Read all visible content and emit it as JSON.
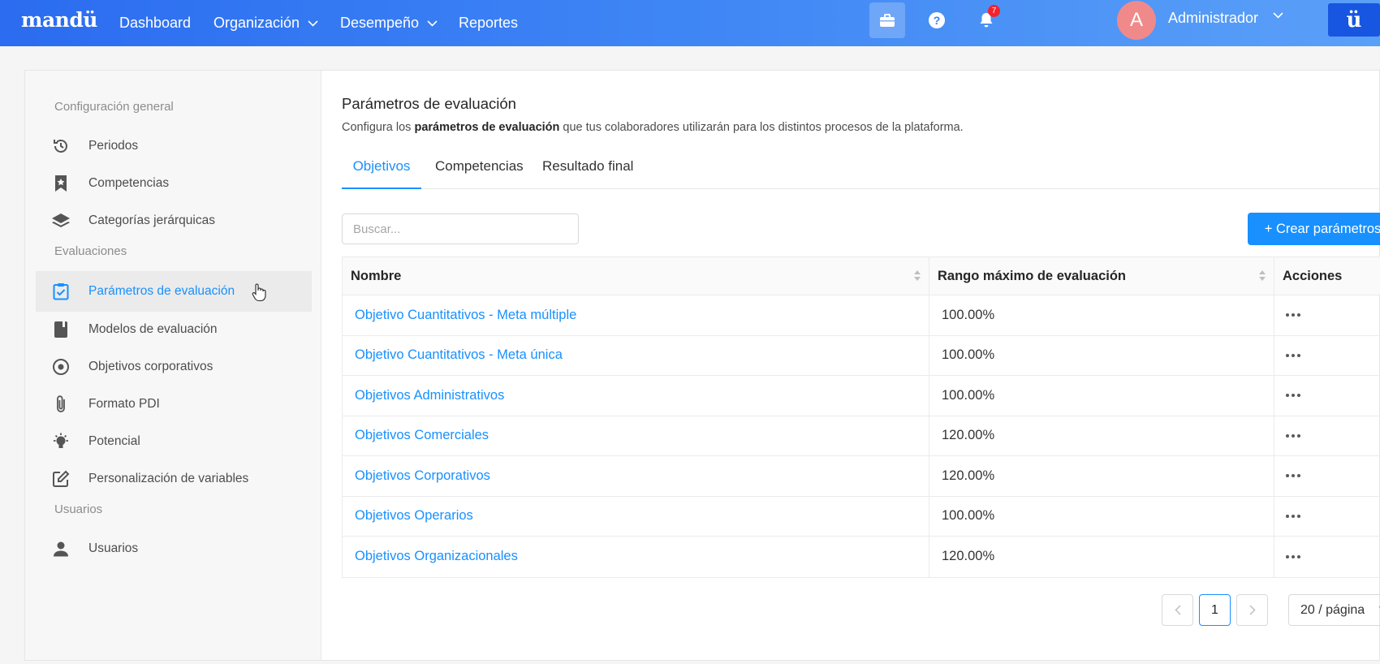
{
  "header": {
    "logo": "mandü",
    "nav": [
      {
        "label": "Dashboard"
      },
      {
        "label": "Organización"
      },
      {
        "label": "Desempeño"
      },
      {
        "label": "Reportes"
      }
    ],
    "notification_count": "7",
    "avatar_letter": "A",
    "user_name": "Administrador",
    "help_glyph": "?",
    "brand_button": "ü"
  },
  "sidebar": {
    "sections": [
      {
        "title": "Configuración general"
      },
      {
        "title": "Evaluaciones"
      },
      {
        "title": "Usuarios"
      }
    ],
    "items": [
      {
        "label": "Periodos",
        "icon": "history-icon"
      },
      {
        "label": "Competencias",
        "icon": "bookmark-star-icon"
      },
      {
        "label": "Categorías jerárquicas",
        "icon": "layers-icon"
      },
      {
        "label": "Parámetros de evaluación",
        "icon": "clipboard-check-icon",
        "active": true
      },
      {
        "label": "Modelos de evaluación",
        "icon": "book-icon"
      },
      {
        "label": "Objetivos corporativos",
        "icon": "target-icon"
      },
      {
        "label": "Formato PDI",
        "icon": "paperclip-icon"
      },
      {
        "label": "Potencial",
        "icon": "lightbulb-icon"
      },
      {
        "label": "Personalización de variables",
        "icon": "edit-icon"
      },
      {
        "label": "Usuarios",
        "icon": "user-icon"
      }
    ]
  },
  "main": {
    "title": "Parámetros de evaluación",
    "description_pre": "Configura los ",
    "description_bold": "parámetros de evaluación",
    "description_post": " que tus colaboradores utilizarán para los distintos procesos de la plataforma.",
    "tabs": [
      {
        "label": "Objetivos",
        "active": true
      },
      {
        "label": "Competencias"
      },
      {
        "label": "Resultado final"
      }
    ],
    "search_placeholder": "Buscar...",
    "create_button": "+ Crear parámetros",
    "table": {
      "columns": [
        "Nombre",
        "Rango máximo de evaluación",
        "Acciones"
      ],
      "rows": [
        {
          "name": "Objetivo Cuantitativos - Meta múltiple",
          "range": "100.00%"
        },
        {
          "name": "Objetivo Cuantitativos - Meta única",
          "range": "100.00%"
        },
        {
          "name": "Objetivos Administrativos",
          "range": "100.00%"
        },
        {
          "name": "Objetivos Comerciales",
          "range": "120.00%"
        },
        {
          "name": "Objetivos Corporativos",
          "range": "120.00%"
        },
        {
          "name": "Objetivos Operarios",
          "range": "100.00%"
        },
        {
          "name": "Objetivos Organizacionales",
          "range": "120.00%"
        }
      ]
    },
    "pagination": {
      "current_page": "1",
      "page_size": "20 / página"
    }
  },
  "colors": {
    "accent": "#1890ff",
    "header_gradient_start": "#2b6cf0",
    "header_gradient_end": "#5aa0f8",
    "badge": "#f5222d",
    "avatar": "#f08a8a"
  }
}
